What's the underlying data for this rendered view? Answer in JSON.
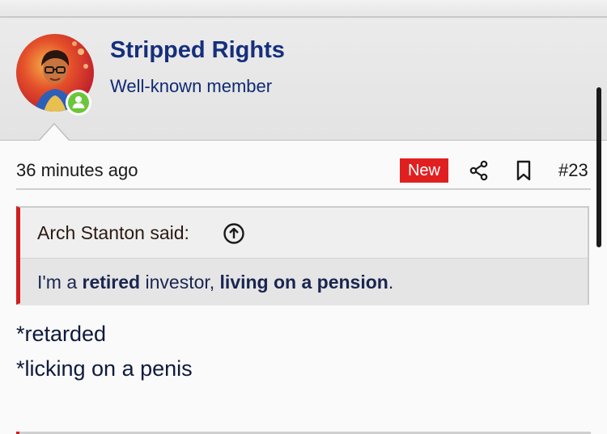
{
  "user": {
    "name": "Stripped Rights",
    "title": "Well-known member",
    "avatar_icon": "user-avatar-photo",
    "status_icon": "online-status-icon"
  },
  "post": {
    "timestamp": "36 minutes ago",
    "new_badge": "New",
    "share_icon": "share-icon",
    "bookmark_icon": "bookmark-icon",
    "number": "#23"
  },
  "quote": {
    "attribution": "Arch Stanton said:",
    "expand_icon": "arrow-up-circle-icon",
    "segments": [
      {
        "text": "I'm a ",
        "bold": false
      },
      {
        "text": "retired",
        "bold": true
      },
      {
        "text": " investor, ",
        "bold": false
      },
      {
        "text": "living on a pension",
        "bold": true
      },
      {
        "text": ".",
        "bold": false
      }
    ]
  },
  "reply": {
    "lines": [
      "*retarded",
      "*licking on a penis"
    ]
  },
  "colors": {
    "name": "#152f7c",
    "badge": "#e02020",
    "quote_accent": "#d11e1e",
    "online": "#6cc63a"
  }
}
